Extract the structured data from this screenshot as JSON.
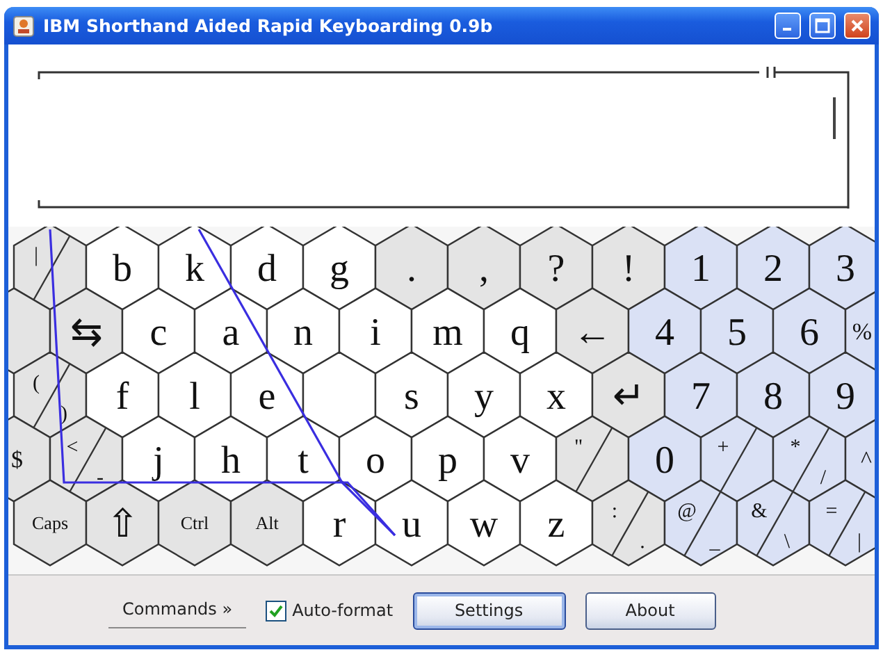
{
  "window": {
    "title": "IBM Shorthand Aided Rapid Keyboarding 0.9b"
  },
  "keyboard": {
    "rows": [
      {
        "keys": [
          {
            "kind": "pair",
            "color": "#e4e4e4",
            "labels": [
              "|"
            ]
          },
          {
            "kind": "key",
            "color": "#ffffff",
            "label": "b"
          },
          {
            "kind": "key",
            "color": "#ffffff",
            "label": "k"
          },
          {
            "kind": "key",
            "color": "#ffffff",
            "label": "d"
          },
          {
            "kind": "key",
            "color": "#ffffff",
            "label": "g"
          },
          {
            "kind": "key",
            "color": "#e4e4e4",
            "label": "."
          },
          {
            "kind": "key",
            "color": "#e4e4e4",
            "label": ","
          },
          {
            "kind": "key",
            "color": "#e4e4e4",
            "label": "?"
          },
          {
            "kind": "key",
            "color": "#e4e4e4",
            "label": "!"
          },
          {
            "kind": "key",
            "color": "#dae1f5",
            "label": "1"
          },
          {
            "kind": "key",
            "color": "#dae1f5",
            "label": "2"
          },
          {
            "kind": "key",
            "color": "#dae1f5",
            "label": "3"
          }
        ]
      },
      {
        "keys": [
          {
            "kind": "blank",
            "color": "#e4e4e4"
          },
          {
            "kind": "key",
            "color": "#e4e4e4",
            "label": "⇆"
          },
          {
            "kind": "key",
            "color": "#ffffff",
            "label": "c"
          },
          {
            "kind": "key",
            "color": "#ffffff",
            "label": "a"
          },
          {
            "kind": "key",
            "color": "#ffffff",
            "label": "n"
          },
          {
            "kind": "key",
            "color": "#ffffff",
            "label": "i"
          },
          {
            "kind": "key",
            "color": "#ffffff",
            "label": "m"
          },
          {
            "kind": "key",
            "color": "#ffffff",
            "label": "q"
          },
          {
            "kind": "key",
            "color": "#e4e4e4",
            "label": "←"
          },
          {
            "kind": "key",
            "color": "#dae1f5",
            "label": "4"
          },
          {
            "kind": "key",
            "color": "#dae1f5",
            "label": "5"
          },
          {
            "kind": "key",
            "color": "#dae1f5",
            "label": "6"
          },
          {
            "kind": "key",
            "color": "#dae1f5",
            "label": "%"
          }
        ]
      },
      {
        "keys": [
          {
            "kind": "pair",
            "color": "#e4e4e4",
            "labels": [
              "(",
              ")"
            ]
          },
          {
            "kind": "key",
            "color": "#ffffff",
            "label": "f"
          },
          {
            "kind": "key",
            "color": "#ffffff",
            "label": "l"
          },
          {
            "kind": "key",
            "color": "#ffffff",
            "label": "e"
          },
          {
            "kind": "blank",
            "color": "#ffffff"
          },
          {
            "kind": "key",
            "color": "#ffffff",
            "label": "s"
          },
          {
            "kind": "key",
            "color": "#ffffff",
            "label": "y"
          },
          {
            "kind": "key",
            "color": "#ffffff",
            "label": "x"
          },
          {
            "kind": "key",
            "color": "#e4e4e4",
            "label": "↵"
          },
          {
            "kind": "key",
            "color": "#dae1f5",
            "label": "7"
          },
          {
            "kind": "key",
            "color": "#dae1f5",
            "label": "8"
          },
          {
            "kind": "key",
            "color": "#dae1f5",
            "label": "9"
          }
        ]
      },
      {
        "keys": [
          {
            "kind": "key",
            "color": "#e4e4e4",
            "label": "$"
          },
          {
            "kind": "pair",
            "color": "#e4e4e4",
            "labels": [
              "<",
              "-"
            ]
          },
          {
            "kind": "key",
            "color": "#ffffff",
            "label": "j"
          },
          {
            "kind": "key",
            "color": "#ffffff",
            "label": "h"
          },
          {
            "kind": "key",
            "color": "#ffffff",
            "label": "t"
          },
          {
            "kind": "key",
            "color": "#ffffff",
            "label": "o"
          },
          {
            "kind": "key",
            "color": "#ffffff",
            "label": "p"
          },
          {
            "kind": "key",
            "color": "#ffffff",
            "label": "v"
          },
          {
            "kind": "pair",
            "color": "#e4e4e4",
            "labels": [
              "\""
            ]
          },
          {
            "kind": "key",
            "color": "#dae1f5",
            "label": "0"
          },
          {
            "kind": "pair",
            "color": "#dae1f5",
            "labels": [
              "+"
            ]
          },
          {
            "kind": "pair",
            "color": "#dae1f5",
            "labels": [
              "*",
              "/"
            ]
          },
          {
            "kind": "key",
            "color": "#dae1f5",
            "label": "^"
          }
        ]
      },
      {
        "keys": [
          {
            "kind": "key",
            "color": "#e4e4e4",
            "label": "Caps"
          },
          {
            "kind": "key",
            "color": "#e4e4e4",
            "label": "⇧"
          },
          {
            "kind": "key",
            "color": "#e4e4e4",
            "label": "Ctrl"
          },
          {
            "kind": "key",
            "color": "#e4e4e4",
            "label": "Alt"
          },
          {
            "kind": "key",
            "color": "#ffffff",
            "label": "r"
          },
          {
            "kind": "key",
            "color": "#ffffff",
            "label": "u"
          },
          {
            "kind": "key",
            "color": "#ffffff",
            "label": "w"
          },
          {
            "kind": "key",
            "color": "#ffffff",
            "label": "z"
          },
          {
            "kind": "pair",
            "color": "#e4e4e4",
            "labels": [
              ":",
              "."
            ]
          },
          {
            "kind": "pair",
            "color": "#dae1f5",
            "labels": [
              "@",
              "_"
            ]
          },
          {
            "kind": "pair",
            "color": "#dae1f5",
            "labels": [
              "&",
              "\\"
            ]
          },
          {
            "kind": "pair",
            "color": "#dae1f5",
            "labels": [
              "=",
              "|"
            ]
          }
        ]
      }
    ]
  },
  "bottom_bar": {
    "commands": "Commands »",
    "auto_format": {
      "label": "Auto-format",
      "checked": true
    },
    "buttons": [
      {
        "label": "Settings",
        "focused": true
      },
      {
        "label": "About",
        "focused": false
      }
    ]
  }
}
